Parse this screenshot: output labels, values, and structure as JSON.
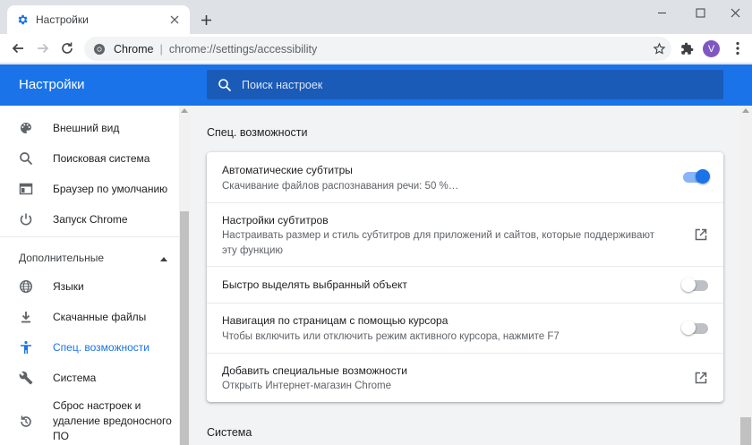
{
  "browser": {
    "tab_title": "Настройки",
    "new_tab": "+",
    "omnibox_brand": "Chrome",
    "omnibox_sep": "|",
    "omnibox_url": "chrome://settings/accessibility",
    "avatar_letter": "V"
  },
  "header": {
    "title": "Настройки",
    "search_placeholder": "Поиск настроек"
  },
  "sidebar": {
    "items": [
      {
        "label": "Внешний вид",
        "icon": "palette-icon"
      },
      {
        "label": "Поисковая система",
        "icon": "search-icon"
      },
      {
        "label": "Браузер по умолчанию",
        "icon": "browser-icon"
      },
      {
        "label": "Запуск Chrome",
        "icon": "power-icon"
      }
    ],
    "section_label": "Дополнительные",
    "advanced_items": [
      {
        "label": "Языки",
        "icon": "globe-icon"
      },
      {
        "label": "Скачанные файлы",
        "icon": "download-icon"
      },
      {
        "label": "Спец. возможности",
        "icon": "accessibility-icon",
        "active": true
      },
      {
        "label": "Система",
        "icon": "wrench-icon"
      },
      {
        "label": "Сброс настроек и удаление вредоносного ПО",
        "icon": "reset-icon"
      }
    ]
  },
  "main": {
    "section_title": "Спец. возможности",
    "rows": [
      {
        "label": "Автоматические субтитры",
        "sub": "Скачивание файлов распознавания речи: 50 %…",
        "control": "toggle",
        "on": true
      },
      {
        "label": "Настройки субтитров",
        "sub": "Настраивать размер и стиль субтитров для приложений и сайтов, которые поддерживают эту функцию",
        "control": "external"
      },
      {
        "label": "Быстро выделять выбранный объект",
        "sub": "",
        "control": "toggle",
        "on": false
      },
      {
        "label": "Навигация по страницам с помощью курсора",
        "sub": "Чтобы включить или отключить режим активного курсора, нажмите F7",
        "control": "toggle",
        "on": false
      },
      {
        "label": "Добавить специальные возможности",
        "sub": "Открыть Интернет-магазин Chrome",
        "control": "external"
      }
    ],
    "next_section_title": "Система"
  },
  "colors": {
    "accent": "#1a73e8",
    "header_bg": "#1a73e8",
    "search_bg": "#1a5bb8",
    "avatar_bg": "#7e57c2"
  }
}
